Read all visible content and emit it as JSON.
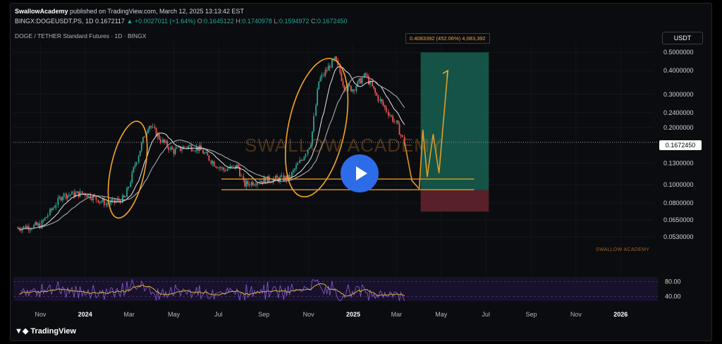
{
  "header": {
    "publisher": "SwallowAcademy",
    "published_text": " published on TradingView.com, March 12, 2025 13:13:42 EST",
    "symbol_line": "BINGX:DOGEUSDT.PS, 1D",
    "last": "0.1672117",
    "change": "▲ +0.0027011 (+1.64%)",
    "o_label": "O:",
    "o": "0.1645122",
    "h_label": "H:",
    "h": "0.1740978",
    "l_label": "L:",
    "l": "0.1594972",
    "c_label": "C:",
    "c": "0.1672450",
    "instrument": "DOGE / TETHER Standard Futures · 1D · BINGX"
  },
  "currency_button": "USDT",
  "current_price_tag": "0.1672450",
  "position_label": "0.4083392 (452.06%) 4,083,392",
  "watermark_text": "SWALLOW ACADEMY",
  "watermark_small": "SWALLOW ACADEMY",
  "brand": "TradingView",
  "colors": {
    "up": "#26a69a",
    "down": "#ef5350",
    "orange": "#f5a623",
    "target_zone": "#1a6b5a",
    "stop_zone": "#6b2630",
    "rsi": "#7e57c2",
    "rsi_ma": "#d9b23a"
  },
  "chart_data": {
    "type": "line",
    "title": "DOGE / TETHER Standard Futures · 1D · BINGX",
    "y_scale": "log",
    "ylim": [
      0.045,
      0.56
    ],
    "y_ticks": [
      "0.5000000",
      "0.4000000",
      "0.3000000",
      "0.2400000",
      "0.2000000",
      "0.1300000",
      "0.1000000",
      "0.0800000",
      "0.0650000",
      "0.0530000"
    ],
    "x_ticks": [
      "Nov",
      "2024",
      "Mar",
      "May",
      "Jul",
      "Sep",
      "Nov",
      "2025",
      "Mar",
      "May",
      "Jul",
      "Sep",
      "Nov",
      "2026"
    ],
    "series": [
      {
        "x": [
          "2023-10-01",
          "2023-11-01",
          "2023-12-01",
          "2024-01-01",
          "2024-02-01",
          "2024-02-25",
          "2024-03-10",
          "2024-03-28",
          "2024-04-15",
          "2024-05-01",
          "2024-05-20",
          "2024-06-05",
          "2024-06-25",
          "2024-07-08",
          "2024-07-28",
          "2024-08-05",
          "2024-08-25",
          "2024-09-15",
          "2024-10-05",
          "2024-10-25",
          "2024-11-05",
          "2024-11-15",
          "2024-12-01",
          "2024-12-08",
          "2024-12-20",
          "2025-01-01",
          "2025-01-18",
          "2025-02-01",
          "2025-02-15",
          "2025-03-01",
          "2025-03-12"
        ],
        "values": [
          0.059,
          0.061,
          0.088,
          0.09,
          0.079,
          0.085,
          0.13,
          0.21,
          0.17,
          0.15,
          0.16,
          0.155,
          0.13,
          0.12,
          0.125,
          0.1,
          0.105,
          0.107,
          0.108,
          0.14,
          0.17,
          0.35,
          0.43,
          0.46,
          0.33,
          0.32,
          0.38,
          0.3,
          0.25,
          0.21,
          0.167
        ]
      },
      {
        "name": "projection",
        "x": [
          "2025-03-12",
          "2025-03-22",
          "2025-04-01",
          "2025-04-06",
          "2025-04-12",
          "2025-04-20",
          "2025-04-28",
          "2025-05-10"
        ],
        "values": [
          0.167,
          0.105,
          0.095,
          0.195,
          0.11,
          0.185,
          0.115,
          0.4
        ]
      }
    ],
    "support_levels": [
      0.107,
      0.094
    ],
    "position": {
      "entry": 0.0935,
      "target": 0.5,
      "stop": 0.072
    },
    "rsi": {
      "ylim": [
        20,
        100
      ],
      "ticks": [
        "80.00",
        "40.00"
      ]
    }
  }
}
